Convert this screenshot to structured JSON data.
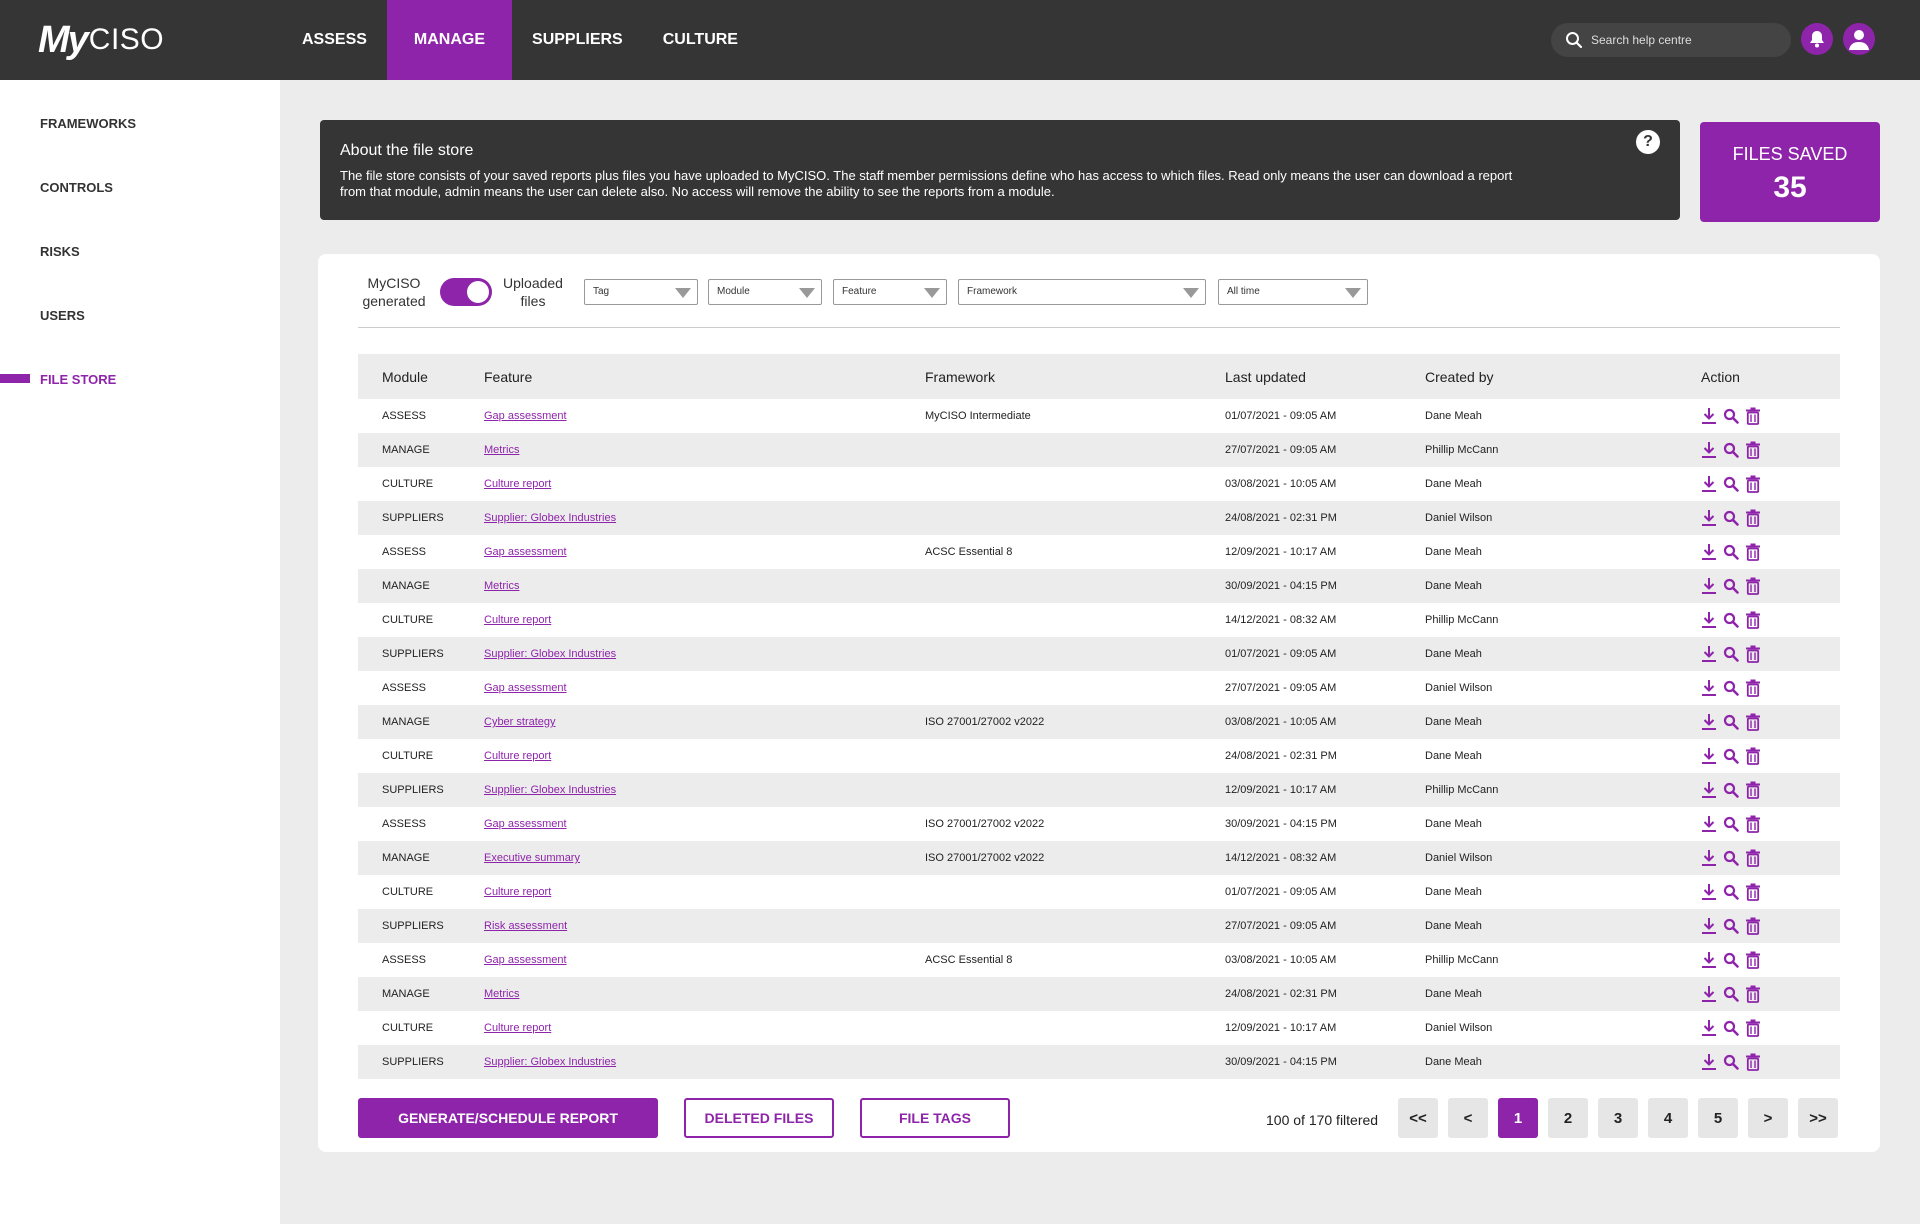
{
  "logo": {
    "my": "My",
    "ciso": "CISO"
  },
  "nav": [
    "ASSESS",
    "MANAGE",
    "SUPPLIERS",
    "CULTURE"
  ],
  "search": {
    "placeholder": "Search help centre"
  },
  "sidebar": [
    "FRAMEWORKS",
    "CONTROLS",
    "RISKS",
    "USERS",
    "FILE STORE"
  ],
  "info": {
    "title": "About the file store",
    "text": "The file store consists of your saved reports plus files you have uploaded to MyCISO. The staff member permissions define who has access to which files. Read only means the user can download a report from that module, admin means the user can delete also. No access will remove the ability to see the reports from a module.",
    "help": "?"
  },
  "files_saved": {
    "label": "FILES SAVED",
    "count": "35"
  },
  "toggle": {
    "left": "MyCISO generated",
    "right": "Uploaded files"
  },
  "filters": [
    "Tag",
    "Module",
    "Feature",
    "Framework",
    "All time"
  ],
  "columns": [
    "Module",
    "Feature",
    "Framework",
    "Last updated",
    "Created by",
    "Action"
  ],
  "rows": [
    [
      "ASSESS",
      "Gap assessment",
      "MyCISO Intermediate",
      "01/07/2021 - 09:05 AM",
      "Dane Meah"
    ],
    [
      "MANAGE",
      "Metrics",
      "",
      "27/07/2021 - 09:05 AM",
      "Phillip McCann"
    ],
    [
      "CULTURE",
      "Culture report",
      "",
      "03/08/2021 - 10:05 AM",
      "Dane Meah"
    ],
    [
      "SUPPLIERS",
      "Supplier: Globex Industries",
      "",
      "24/08/2021 - 02:31 PM",
      "Daniel Wilson"
    ],
    [
      "ASSESS",
      "Gap assessment",
      "ACSC Essential 8",
      "12/09/2021 - 10:17 AM",
      "Dane Meah"
    ],
    [
      "MANAGE",
      "Metrics",
      "",
      "30/09/2021 - 04:15 PM",
      "Dane Meah"
    ],
    [
      "CULTURE",
      "Culture report",
      "",
      "14/12/2021 - 08:32 AM",
      "Phillip McCann"
    ],
    [
      "SUPPLIERS",
      "Supplier: Globex Industries",
      "",
      "01/07/2021 - 09:05 AM",
      "Dane Meah"
    ],
    [
      "ASSESS",
      "Gap assessment",
      "",
      "27/07/2021 - 09:05 AM",
      "Daniel Wilson"
    ],
    [
      "MANAGE",
      "Cyber strategy",
      "ISO 27001/27002 v2022",
      "03/08/2021 - 10:05 AM",
      "Dane Meah"
    ],
    [
      "CULTURE",
      "Culture report",
      "",
      "24/08/2021 - 02:31 PM",
      "Dane Meah"
    ],
    [
      "SUPPLIERS",
      "Supplier: Globex Industries",
      "",
      "12/09/2021 - 10:17 AM",
      "Phillip McCann"
    ],
    [
      "ASSESS",
      "Gap assessment",
      "ISO 27001/27002 v2022",
      "30/09/2021 - 04:15 PM",
      "Dane Meah"
    ],
    [
      "MANAGE",
      "Executive summary",
      "ISO 27001/27002 v2022",
      "14/12/2021 - 08:32 AM",
      "Daniel Wilson"
    ],
    [
      "CULTURE",
      "Culture report",
      "",
      "01/07/2021 - 09:05 AM",
      "Dane Meah"
    ],
    [
      "SUPPLIERS",
      "Risk assessment",
      "",
      "27/07/2021 - 09:05 AM",
      "Dane Meah"
    ],
    [
      "ASSESS",
      "Gap assessment",
      "ACSC Essential 8",
      "03/08/2021 - 10:05 AM",
      "Phillip McCann"
    ],
    [
      "MANAGE",
      "Metrics",
      "",
      "24/08/2021 - 02:31 PM",
      "Dane Meah"
    ],
    [
      "CULTURE",
      "Culture report",
      "",
      "12/09/2021 - 10:17 AM",
      "Daniel Wilson"
    ],
    [
      "SUPPLIERS",
      "Supplier: Globex Industries",
      "",
      "30/09/2021 - 04:15 PM",
      "Dane Meah"
    ]
  ],
  "buttons": {
    "generate": "GENERATE/SCHEDULE REPORT",
    "deleted": "DELETED FILES",
    "tags": "FILE TAGS"
  },
  "pagination": {
    "info": "100 of 170 filtered",
    "pages": [
      "<<",
      "<",
      "1",
      "2",
      "3",
      "4",
      "5",
      ">",
      ">>"
    ],
    "active": "1"
  },
  "colors": {
    "accent": "#8e24aa",
    "dark": "#353535",
    "background": "#ececec"
  }
}
